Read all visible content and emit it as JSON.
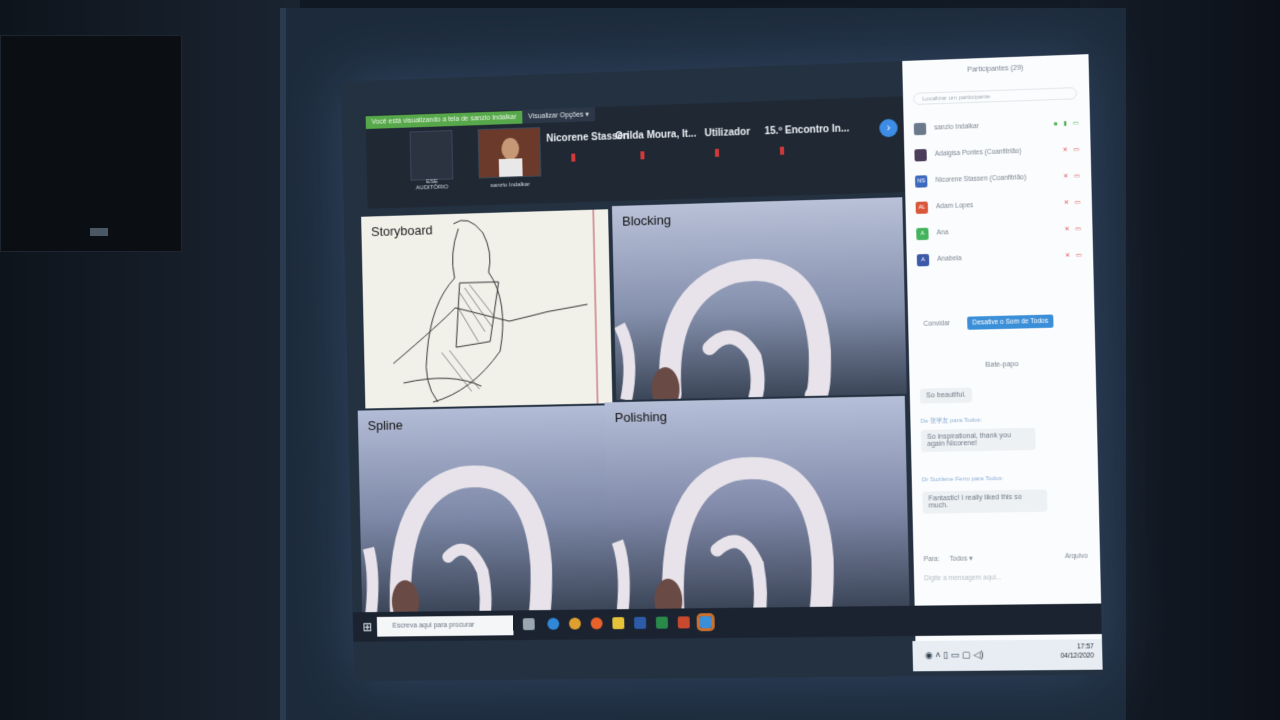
{
  "zoom": {
    "viewing_message": "Você está visualizando a tela de sanzio Indalkar",
    "view_options": "Visualizar Opções ▾",
    "thumbs": [
      {
        "label": "ESE AUDITÓRIO"
      },
      {
        "label": "sanzio Indalkar"
      }
    ],
    "participants_strip": [
      "Nicorene Stassen",
      "Orilda Moura, It...",
      "Utilizador",
      "15.º Encontro In..."
    ],
    "next_label": "›"
  },
  "panels": {
    "storyboard": "Storyboard",
    "blocking": "Blocking",
    "spline": "Spline",
    "polishing": "Polishing"
  },
  "sidebar": {
    "title": "Participantes (29)",
    "search_placeholder": "Localizar um participante",
    "participants": [
      {
        "initials": "",
        "name": "sanzio Indalkar",
        "color": "#6a7a8c"
      },
      {
        "initials": "",
        "name": "Adalgisa Pontes (Coanfitrião)",
        "color": "#4b3c5a"
      },
      {
        "initials": "NS",
        "name": "Nicorene Stassen (Coanfitrião)",
        "color": "#3d6ac0"
      },
      {
        "initials": "AL",
        "name": "Adam Lopes",
        "color": "#d9583b"
      },
      {
        "initials": "A",
        "name": "Ana",
        "color": "#44b45c"
      },
      {
        "initials": "A",
        "name": "Anabela",
        "color": "#3d5aa8"
      }
    ],
    "invite": "Convidar",
    "mute_all": "Desative o Som de Todos",
    "chat_title": "Bate-papo",
    "chat": [
      {
        "from": "",
        "text": "So beautiful."
      },
      {
        "from": "De 张学友 para Todos:",
        "text": "So inspirational, thank you again Nicorene!"
      },
      {
        "from": "Dr Suzilene Ferro para Todos:",
        "text": "Fantastic! I really liked this so much."
      }
    ],
    "to_label": "Para:",
    "to_value": "Todos ▾",
    "file_label": "Arquivo",
    "input_placeholder": "Digite a mensagem aqui..."
  },
  "taskbar": {
    "search_placeholder": "Escreva aqui para procurar",
    "time": "17:57",
    "date": "04/12/2020"
  },
  "colors": {
    "accent": "#3b8ed8",
    "viewing_green": "#57a84a"
  }
}
